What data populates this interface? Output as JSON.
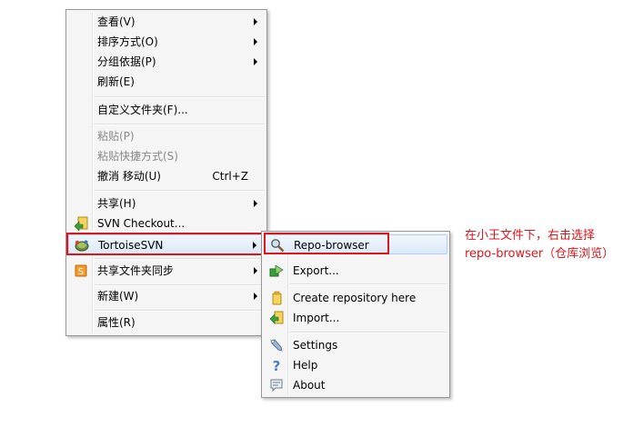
{
  "context_menu": {
    "items": [
      {
        "label": "查看(V)"
      },
      {
        "label": "排序方式(O)"
      },
      {
        "label": "分组依据(P)"
      },
      {
        "label": "刷新(E)"
      },
      {
        "label": "自定义文件夹(F)..."
      },
      {
        "label": "粘贴(P)"
      },
      {
        "label": "粘贴快捷方式(S)"
      },
      {
        "label": "撤消 移动(U)",
        "shortcut": "Ctrl+Z"
      },
      {
        "label": "共享(H)"
      },
      {
        "label": "SVN Checkout..."
      },
      {
        "label": "TortoiseSVN"
      },
      {
        "label": "共享文件夹同步"
      },
      {
        "label": "新建(W)"
      },
      {
        "label": "属性(R)"
      }
    ]
  },
  "submenu": {
    "items": [
      {
        "label": "Repo-browser"
      },
      {
        "label": "Export..."
      },
      {
        "label": "Create repository here"
      },
      {
        "label": "Import..."
      },
      {
        "label": "Settings"
      },
      {
        "label": "Help"
      },
      {
        "label": "About"
      }
    ]
  },
  "annotation": {
    "text": "在小王文件下，右击选择\nrepo-browser（仓库浏览）"
  },
  "colors": {
    "annotation": "#e0141b",
    "highlight_border": "#e0141b",
    "menu_background": "#f5f5f5"
  }
}
